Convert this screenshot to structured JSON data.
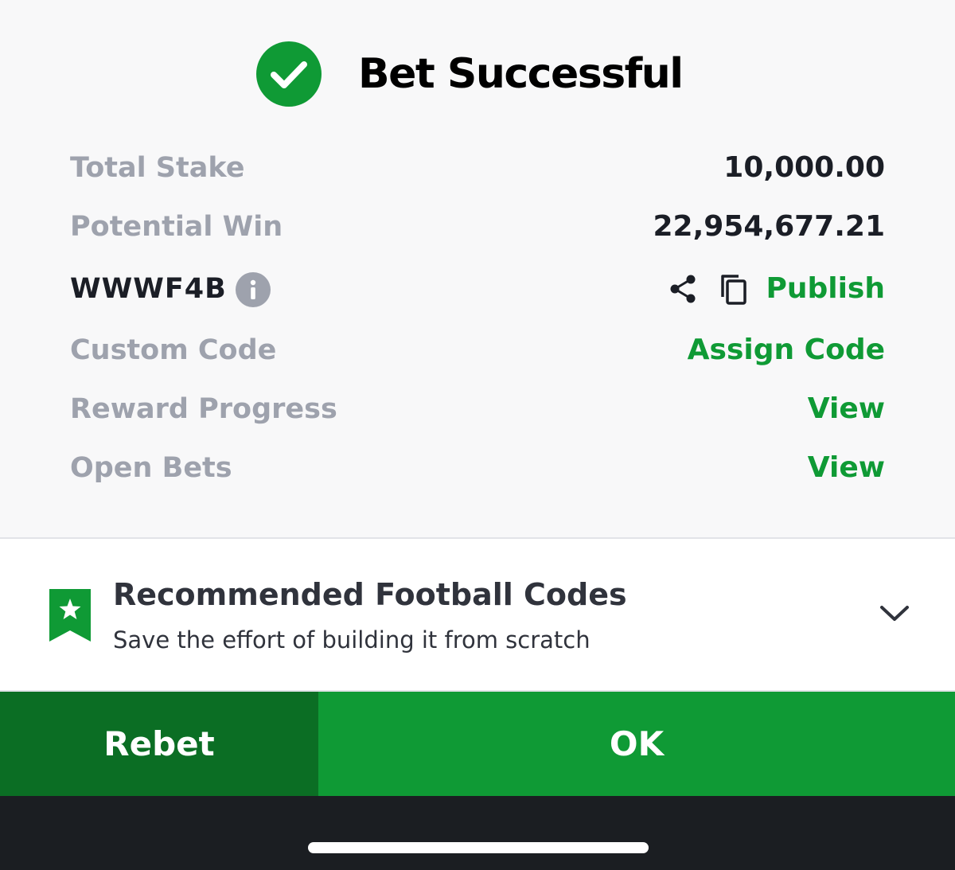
{
  "header": {
    "icon": "check-circle-icon",
    "title": "Bet Successful"
  },
  "summary": {
    "total_stake_label": "Total Stake",
    "total_stake_value": "10,000.00",
    "potential_win_label": "Potential Win",
    "potential_win_value": "22,954,677.21",
    "booking_code": "WWWF4B",
    "publish_label": "Publish",
    "custom_code_label": "Custom Code",
    "assign_code_label": "Assign Code",
    "reward_progress_label": "Reward Progress",
    "reward_view_label": "View",
    "open_bets_label": "Open Bets",
    "open_bets_view_label": "View"
  },
  "recommended": {
    "title": "Recommended Football Codes",
    "subtitle": "Save the effort of building it from scratch"
  },
  "actions": {
    "rebet_label": "Rebet",
    "ok_label": "OK"
  },
  "colors": {
    "brand_green": "#0f9a35",
    "dark_green": "#0b6e24",
    "muted_gray": "#9ea2ad",
    "text_dark": "#1b1e26"
  }
}
